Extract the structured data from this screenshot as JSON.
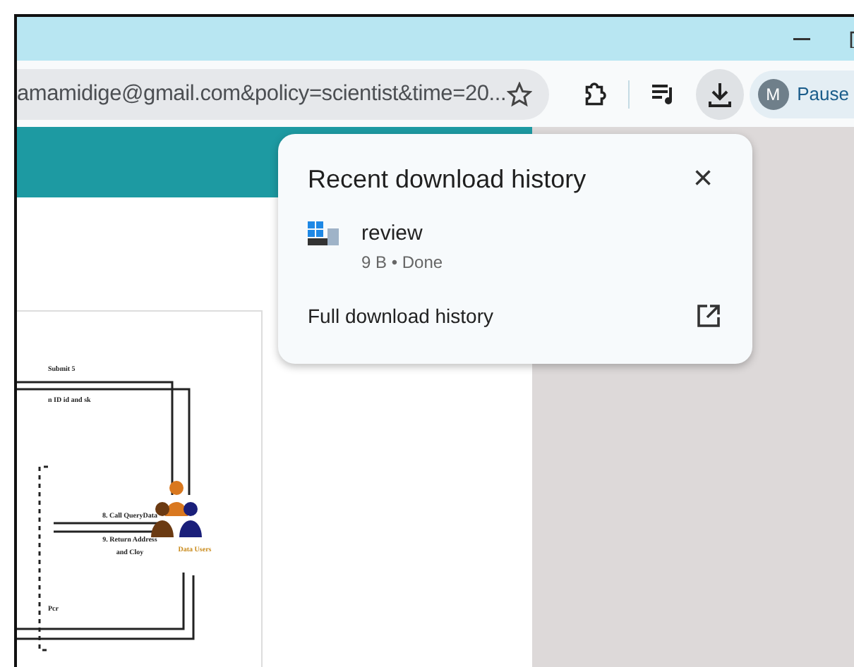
{
  "toolbar": {
    "address": "amamidige@gmail.com&policy=scientist&time=20...",
    "bookmarked": false,
    "profile": {
      "initial": "M",
      "label": "Pause"
    }
  },
  "document": {
    "labels": [
      {
        "kind": "top",
        "text": "Submit 5"
      },
      {
        "kind": "top2",
        "text": "n ID id and sk"
      },
      {
        "kind": "call",
        "text": "8. Call QueryData"
      },
      {
        "kind": "return",
        "text": "9. Return Address"
      },
      {
        "kind": "return2",
        "text": "and Cloy"
      },
      {
        "kind": "users",
        "text": "Data Users"
      },
      {
        "kind": "bottom",
        "text": "Pcr"
      }
    ]
  },
  "download_popup": {
    "title": "Recent download history",
    "close": "×",
    "items": [
      {
        "name": "review",
        "meta": "9 B • Done"
      }
    ],
    "footer": "Full download history"
  }
}
